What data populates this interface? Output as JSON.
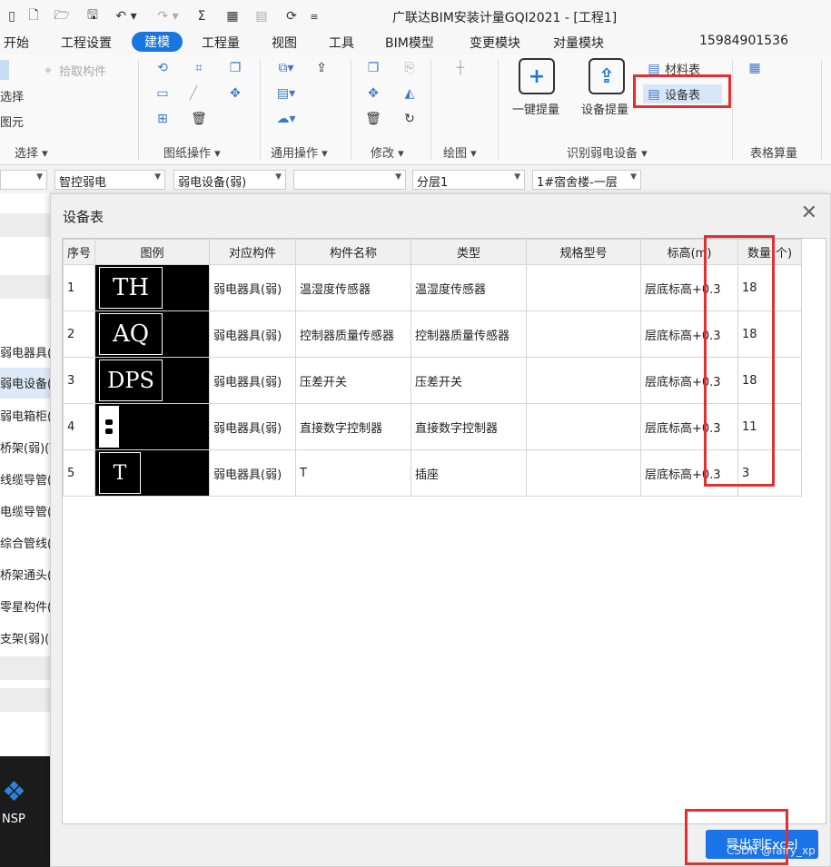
{
  "window": {
    "title": "广联达BIM安装计量GQI2021 - [工程1]"
  },
  "menu": {
    "items": [
      "开始",
      "工程设置",
      "建模",
      "工程量",
      "视图",
      "工具",
      "BIM模型",
      "变更模块",
      "对量模块"
    ],
    "active": "建模",
    "phone": "15984901536"
  },
  "ribbon": {
    "select_group": {
      "pick_component": "拾取构件",
      "select_partial": "选择",
      "unit_partial": "图元",
      "label": "选择"
    },
    "drawing_ops": {
      "label": "图纸操作"
    },
    "general_ops": {
      "label": "通用操作"
    },
    "modify": {
      "label": "修改"
    },
    "draw": {
      "label": "绘图"
    },
    "identify": {
      "one_key": "一键提量",
      "device_takeoff": "设备提量",
      "material_table": "材料表",
      "device_table": "设备表",
      "label": "识别弱电设备"
    },
    "table_calc": {
      "label": "表格算量"
    }
  },
  "propbar": {
    "dropdown1": "智控弱电",
    "dropdown2": "弱电设备(弱)",
    "dropdown3": "",
    "floor": "分层1",
    "building": "1#宿舍楼-一层"
  },
  "left_panel": {
    "items": [
      "弱电器具(",
      "弱电设备(",
      "弱电箱柜(",
      "桥架(弱)(V",
      "线缆导管(",
      "电缆导管(",
      "综合管线(",
      "桥架通头(",
      "零星构件(",
      "支架(弱)(N"
    ],
    "desktop_label": "NSP"
  },
  "dialog": {
    "title": "设备表",
    "columns": [
      "序号",
      "图例",
      "对应构件",
      "构件名称",
      "类型",
      "规格型号",
      "标高(m)",
      "数量(个)"
    ],
    "rows": [
      {
        "no": "1",
        "legend": "TH",
        "component": "弱电器具(弱)",
        "name": "温湿度传感器",
        "type": "温湿度传感器",
        "spec": "",
        "elevation": "层底标高+0.3",
        "qty": "18"
      },
      {
        "no": "2",
        "legend": "AQ",
        "component": "弱电器具(弱)",
        "name": "控制器质量传感器",
        "type": "控制器质量传感器",
        "spec": "",
        "elevation": "层底标高+0.3",
        "qty": "18"
      },
      {
        "no": "3",
        "legend": "DPS",
        "component": "弱电器具(弱)",
        "name": "压差开关",
        "type": "压差开关",
        "spec": "",
        "elevation": "层底标高+0.3",
        "qty": "18"
      },
      {
        "no": "4",
        "legend": "",
        "component": "弱电器具(弱)",
        "name": "直接数字控制器",
        "type": "直接数字控制器",
        "spec": "",
        "elevation": "层底标高+0.3",
        "qty": "11"
      },
      {
        "no": "5",
        "legend": "T",
        "component": "弱电器具(弱)",
        "name": "T",
        "type": "插座",
        "spec": "",
        "elevation": "层底标高+0.3",
        "qty": "3"
      }
    ],
    "export_label": "导出到Excel"
  },
  "watermark": "CSDN @fairy_xp",
  "colors": {
    "accent": "#1976e0",
    "highlight": "#e03030"
  }
}
